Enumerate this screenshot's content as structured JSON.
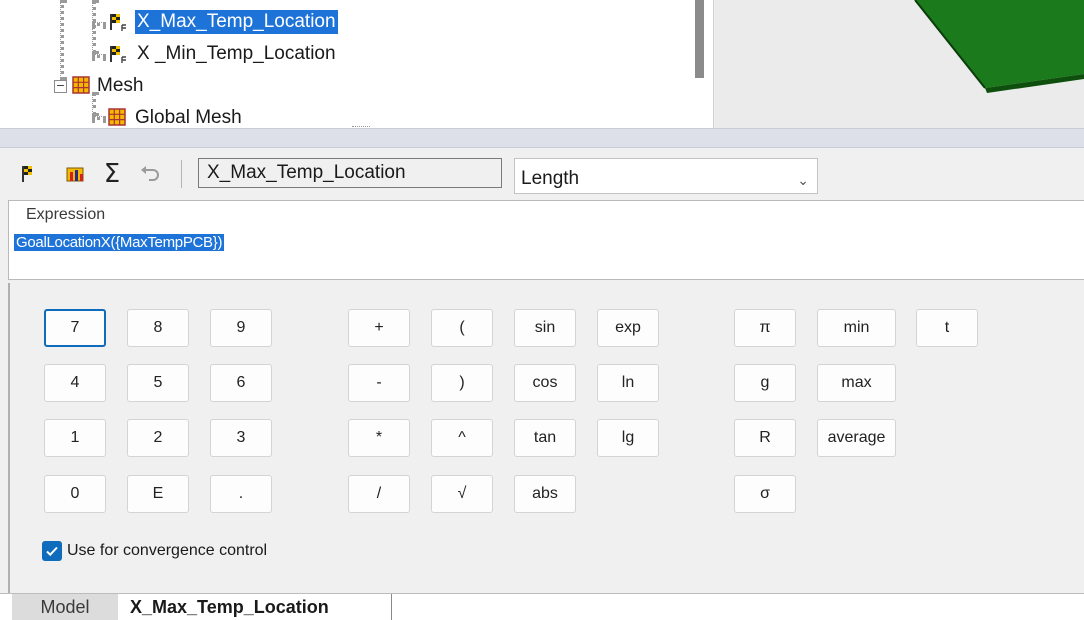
{
  "tree": {
    "items": [
      {
        "label": "X_Max_Temp_Location",
        "icon": "goal-flag-icon",
        "selected": true
      },
      {
        "label": "X _Min_Temp_Location",
        "icon": "goal-flag-icon",
        "selected": false
      },
      {
        "label": "Mesh",
        "icon": "mesh-icon",
        "expander": "−"
      },
      {
        "label": "Global Mesh",
        "icon": "global-mesh-icon"
      }
    ]
  },
  "toolbar": {
    "goal_name": "X_Max_Temp_Location",
    "unit": "Length",
    "icons": [
      "goal-flag-icon",
      "chart-goal-icon",
      "sum-icon",
      "undo-icon"
    ]
  },
  "expression": {
    "label": "Expression",
    "value": "GoalLocationX({MaxTempPCB})"
  },
  "keypad": {
    "digits": [
      "7",
      "8",
      "9",
      "4",
      "5",
      "6",
      "1",
      "2",
      "3",
      "0",
      "E",
      "."
    ],
    "operators": [
      "+",
      "(",
      "-",
      ")",
      "*",
      "^",
      "/",
      "√"
    ],
    "functions": [
      "sin",
      "exp",
      "cos",
      "ln",
      "tan",
      "lg",
      "abs"
    ],
    "constants": [
      "π",
      "min",
      "t",
      "g",
      "max",
      "R",
      "average",
      "σ"
    ]
  },
  "convergence": {
    "label": "Use for convergence control",
    "checked": true
  },
  "tabs": [
    {
      "label": "Model",
      "active": false
    },
    {
      "label": "X_Max_Temp_Location",
      "active": true
    }
  ],
  "colors": {
    "selection": "#1e73d8",
    "accent": "#0f6cbd",
    "model_green": "#1b7a1b"
  }
}
